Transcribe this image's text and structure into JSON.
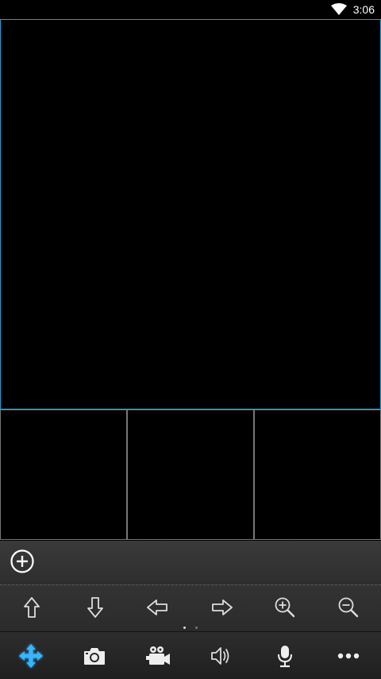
{
  "status_bar": {
    "time": "3:06",
    "icons": [
      "wifi-icon"
    ]
  },
  "video_grid": {
    "panes": [
      "main-pane",
      "pane-2",
      "pane-3",
      "pane-4"
    ]
  },
  "add_bar": {
    "icon": "add-circle-icon"
  },
  "ptz_controls": {
    "buttons": [
      "arrow-up-icon",
      "arrow-down-icon",
      "arrow-left-icon",
      "arrow-right-icon",
      "zoom-in-icon",
      "zoom-out-icon"
    ],
    "page_count": 2,
    "active_page": 1
  },
  "toolbar": {
    "buttons": [
      "ptz-move-icon",
      "camera-icon",
      "video-record-icon",
      "speaker-icon",
      "microphone-icon",
      "more-icon"
    ],
    "accent": "#35b6ff"
  }
}
